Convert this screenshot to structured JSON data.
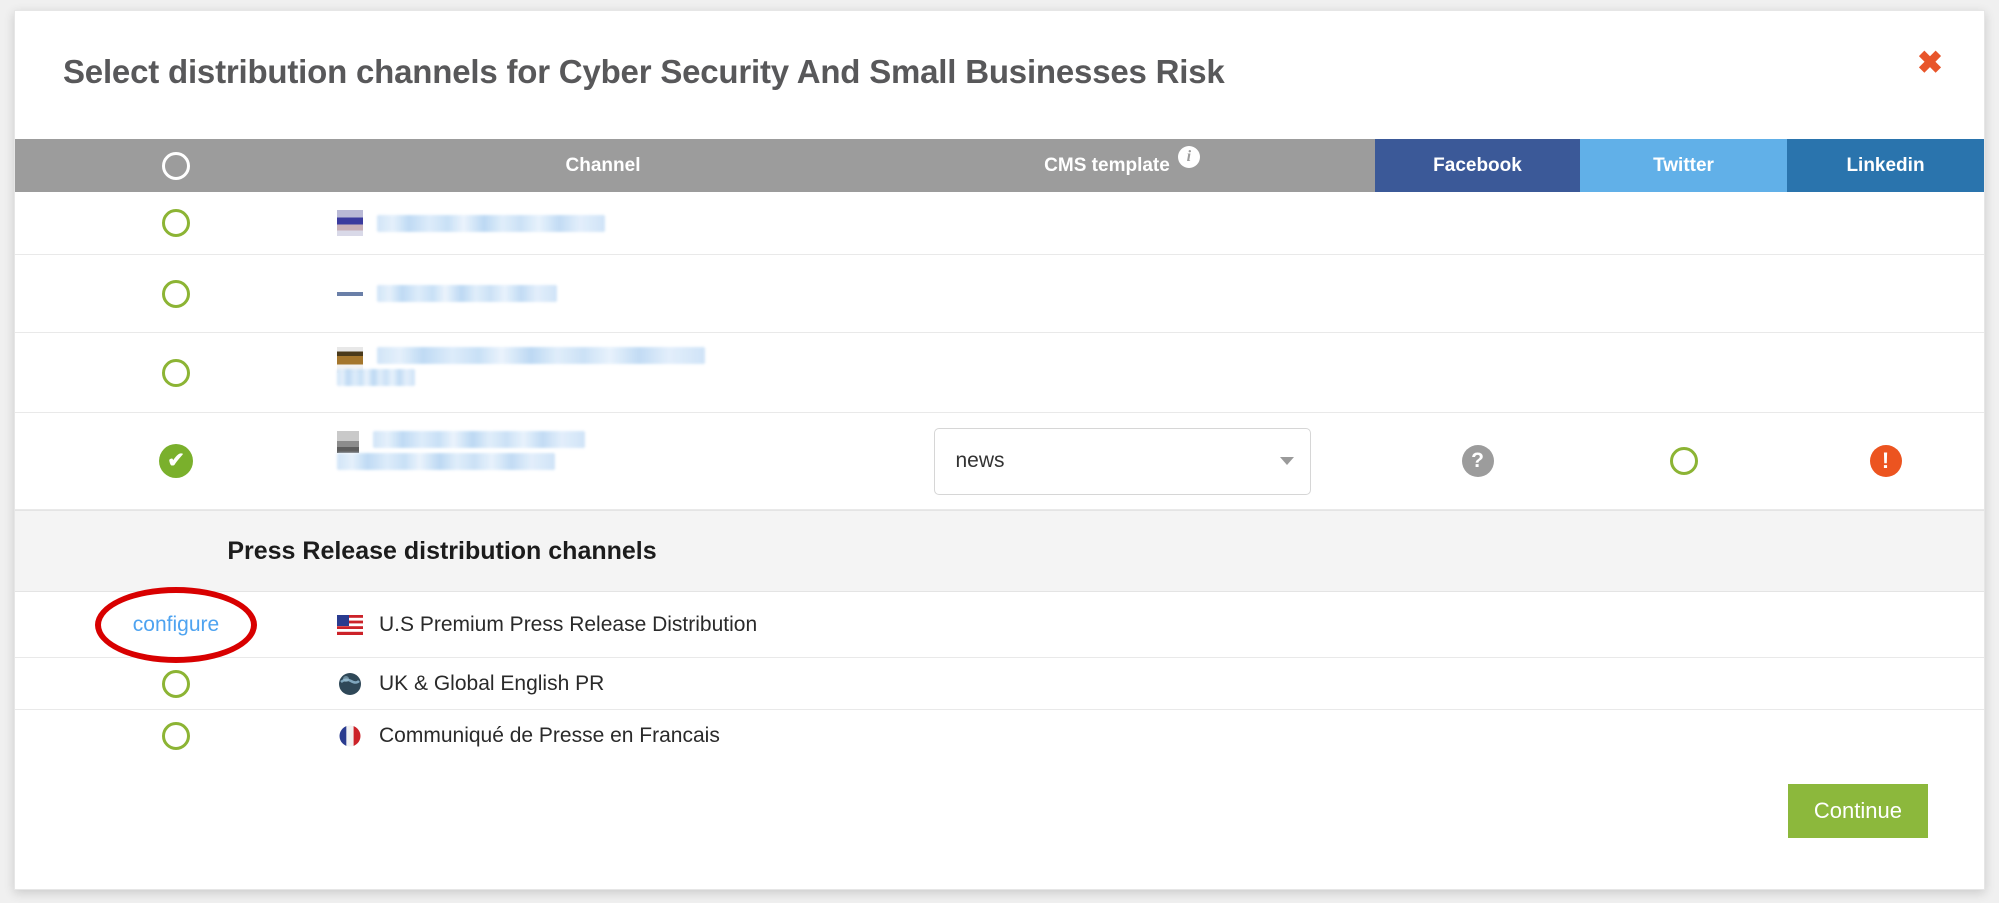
{
  "dialog": {
    "title": "Select distribution channels for Cyber Security And Small Businesses Risk",
    "close_label": "✖"
  },
  "table": {
    "columns": {
      "select": "",
      "channel": "Channel",
      "cms_template": "CMS template",
      "cms_info_icon": "i",
      "facebook": "Facebook",
      "twitter": "Twitter",
      "linkedin": "Linkedin"
    },
    "column_colors": {
      "header_bg": "#9c9c9c",
      "facebook": "#3b5998",
      "twitter": "#61b0e8",
      "linkedin": "#2a74ad"
    }
  },
  "cms_rows": [
    {
      "id": "row-1",
      "selected": false,
      "channel_text": "",
      "redacted": true,
      "redact_widths": [
        "228px",
        "206px",
        "96px"
      ],
      "cms_template": "",
      "facebook_status": "",
      "twitter_status": "",
      "linkedin_status": ""
    },
    {
      "id": "row-2",
      "selected": false,
      "channel_text": "",
      "redacted": true,
      "redact_widths": [
        "152px",
        "182px",
        "100px"
      ],
      "cms_template": "",
      "facebook_status": "",
      "twitter_status": "",
      "linkedin_status": ""
    },
    {
      "id": "row-3",
      "selected": false,
      "channel_text": "",
      "redacted": true,
      "redact_widths": [
        "328px",
        "360px",
        "78px"
      ],
      "cms_template": "",
      "facebook_status": "",
      "twitter_status": "",
      "linkedin_status": ""
    },
    {
      "id": "row-4",
      "selected": true,
      "channel_text": "",
      "redacted": true,
      "redact_widths": [
        "212px",
        "178px",
        "218px"
      ],
      "cms_template": "news",
      "facebook_status": "question",
      "twitter_status": "empty",
      "linkedin_status": "alert"
    }
  ],
  "press_release_section": {
    "title": "Press Release distribution channels",
    "rows": [
      {
        "id": "pr-us",
        "action_label": "configure",
        "action_type": "link",
        "annotated": true,
        "annotation_color": "#d80000",
        "flag": "us-flag-icon",
        "label": "U.S Premium Press Release Distribution"
      },
      {
        "id": "pr-uk",
        "action_label": "",
        "action_type": "radio",
        "annotated": false,
        "flag": "globe-icon",
        "label": "UK & Global English PR"
      },
      {
        "id": "pr-fr",
        "action_label": "",
        "action_type": "radio",
        "annotated": false,
        "flag": "fr-flag-icon",
        "label": "Communiqué de Presse en Francais"
      }
    ]
  },
  "footer": {
    "continue_label": "Continue",
    "continue_color": "#8cb83c"
  },
  "status_icons": {
    "question": "?",
    "alert": "!",
    "check": "✔"
  }
}
